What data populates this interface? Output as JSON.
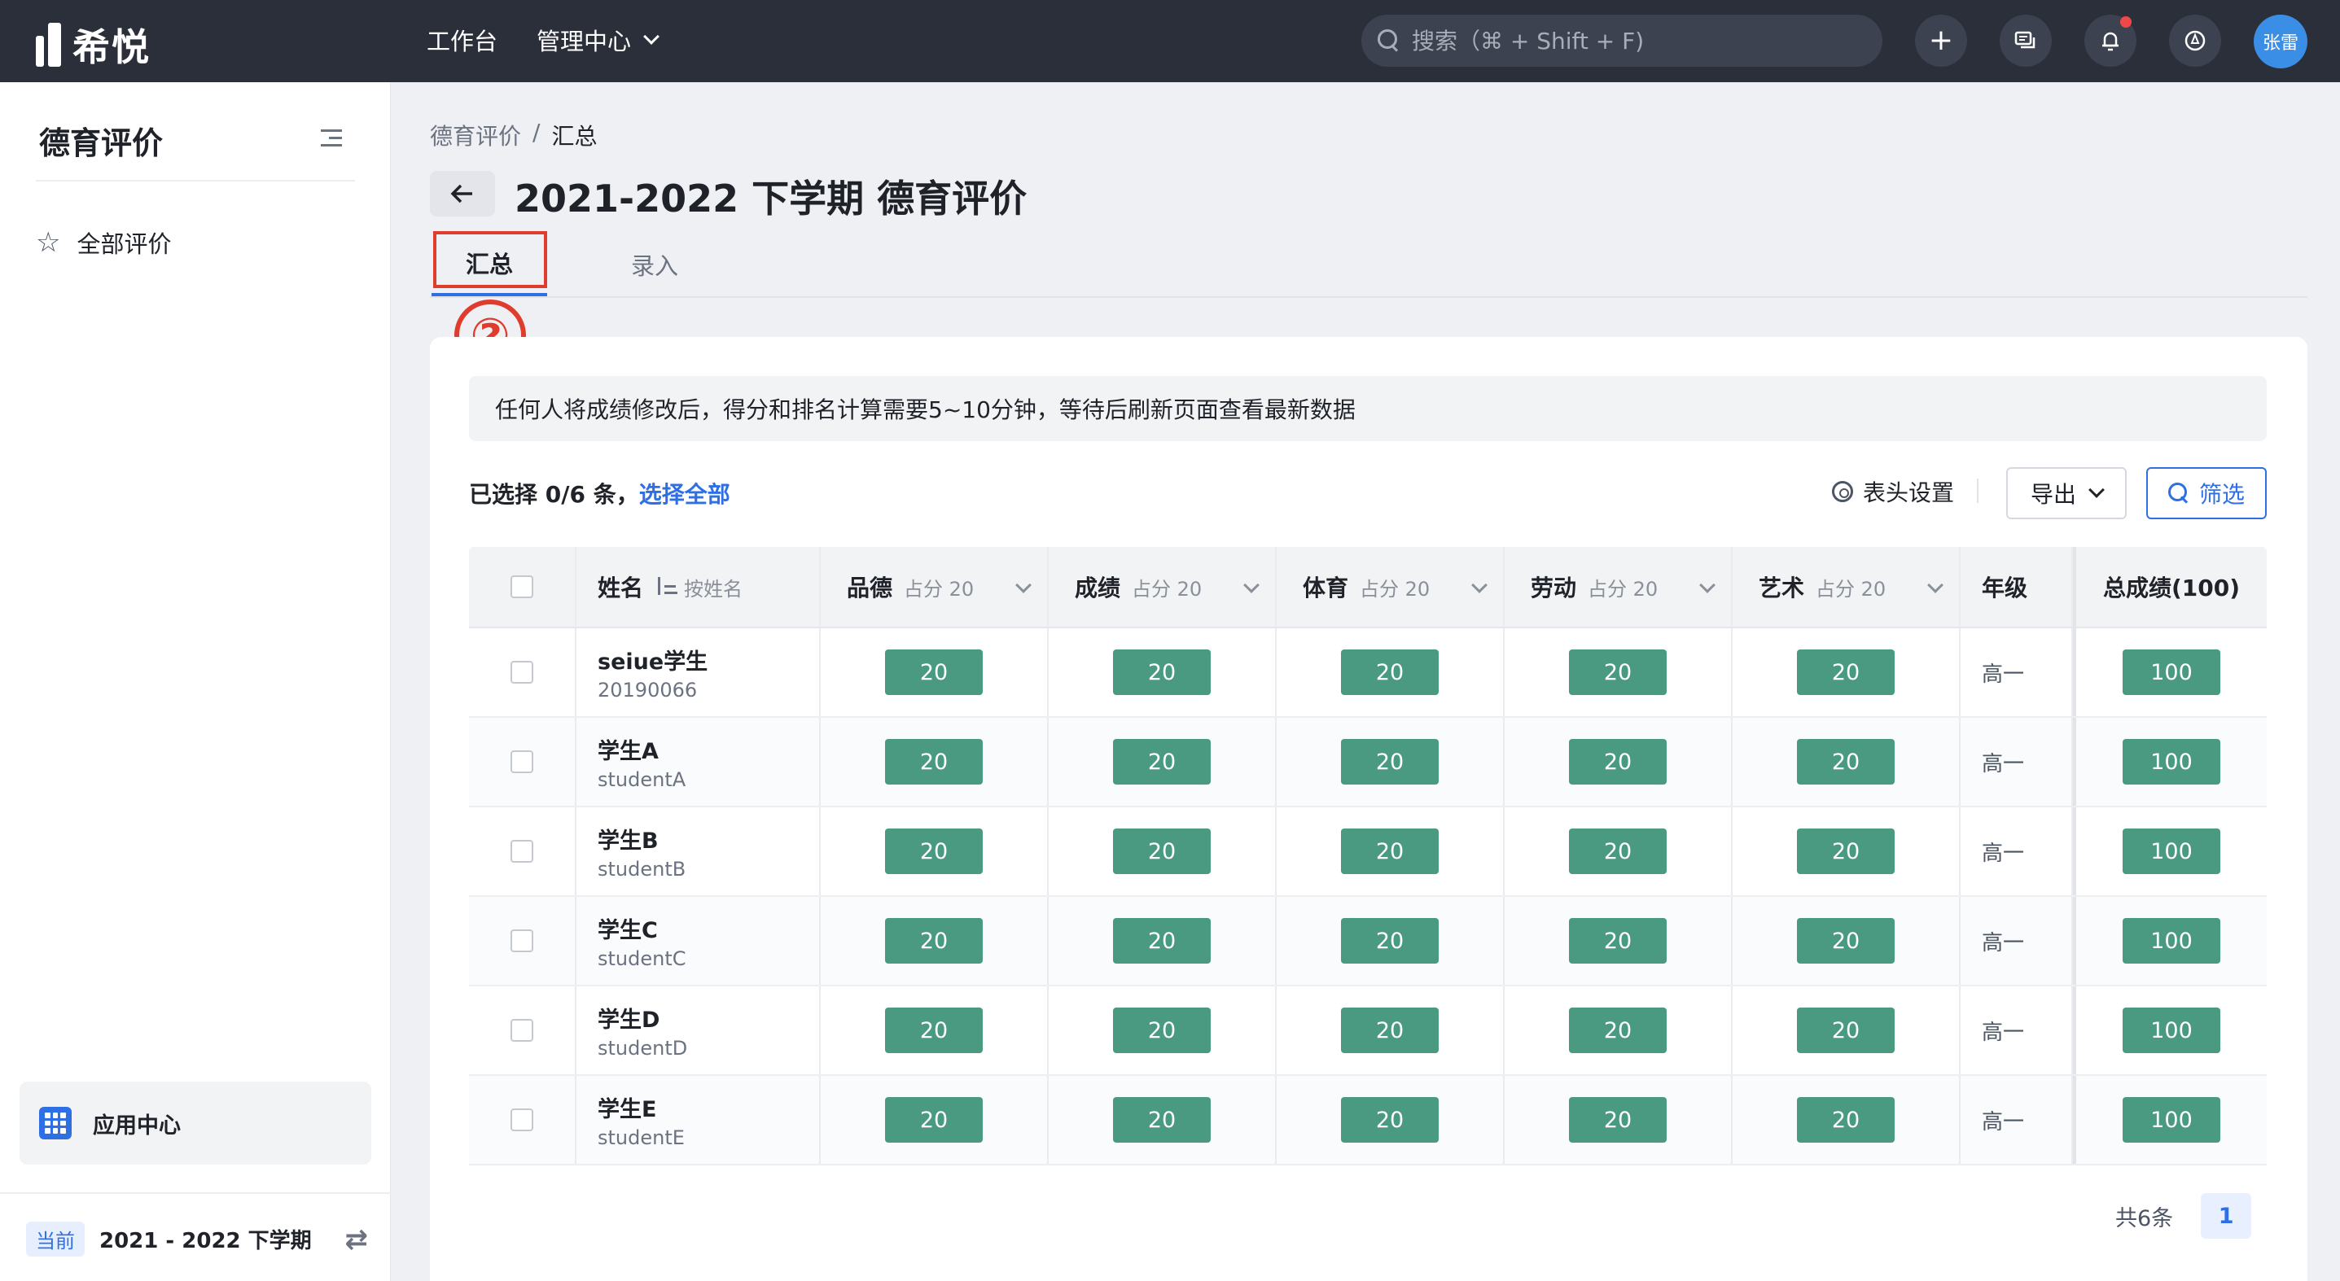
{
  "app": {
    "name": "希悦"
  },
  "topnav": {
    "workbench": "工作台",
    "admin": "管理中心"
  },
  "search": {
    "placeholder": "搜索（⌘ + Shift + F)"
  },
  "user": {
    "avatar_text": "张雷"
  },
  "sidebar": {
    "title": "德育评价",
    "items": [
      {
        "label": "全部评价",
        "icon": "star-icon"
      }
    ],
    "app_center": "应用中心",
    "term_badge": "当前",
    "term": "2021 - 2022 下学期"
  },
  "breadcrumb": {
    "root": "德育评价",
    "separator": "/",
    "current": "汇总"
  },
  "page": {
    "title": "2021-2022 下学期 德育评价"
  },
  "tabs": [
    {
      "label": "汇总",
      "active": true
    },
    {
      "label": "录入",
      "active": false
    }
  ],
  "annotation": {
    "step": "②",
    "color": "#e03c2d"
  },
  "notice": "任何人将成绩修改后，得分和排名计算需要5~10分钟，等待后刷新页面查看最新数据",
  "toolbar": {
    "selected": "已选择 0/6 条，",
    "select_all": "选择全部",
    "header_settings": "表头设置",
    "export": "导出",
    "filter": "筛选"
  },
  "table": {
    "headers": {
      "name": "姓名",
      "name_sort": "按姓名",
      "scores": [
        {
          "label": "品德",
          "weight": "占分 20"
        },
        {
          "label": "成绩",
          "weight": "占分 20"
        },
        {
          "label": "体育",
          "weight": "占分 20"
        },
        {
          "label": "劳动",
          "weight": "占分 20"
        },
        {
          "label": "艺术",
          "weight": "占分 20"
        }
      ],
      "grade": "年级",
      "total": "总成绩(100)"
    },
    "rows": [
      {
        "name": "seiue学生",
        "id": "20190066",
        "scores": [
          "20",
          "20",
          "20",
          "20",
          "20"
        ],
        "grade": "高一",
        "total": "100"
      },
      {
        "name": "学生A",
        "id": "studentA",
        "scores": [
          "20",
          "20",
          "20",
          "20",
          "20"
        ],
        "grade": "高一",
        "total": "100"
      },
      {
        "name": "学生B",
        "id": "studentB",
        "scores": [
          "20",
          "20",
          "20",
          "20",
          "20"
        ],
        "grade": "高一",
        "total": "100"
      },
      {
        "name": "学生C",
        "id": "studentC",
        "scores": [
          "20",
          "20",
          "20",
          "20",
          "20"
        ],
        "grade": "高一",
        "total": "100"
      },
      {
        "name": "学生D",
        "id": "studentD",
        "scores": [
          "20",
          "20",
          "20",
          "20",
          "20"
        ],
        "grade": "高一",
        "total": "100"
      },
      {
        "name": "学生E",
        "id": "studentE",
        "scores": [
          "20",
          "20",
          "20",
          "20",
          "20"
        ],
        "grade": "高一",
        "total": "100"
      }
    ]
  },
  "pagination": {
    "total": "共6条",
    "current": "1"
  },
  "colors": {
    "accent": "#2f6fe4",
    "score_bg": "#4a9a82",
    "topbar": "#2b2f3a"
  }
}
